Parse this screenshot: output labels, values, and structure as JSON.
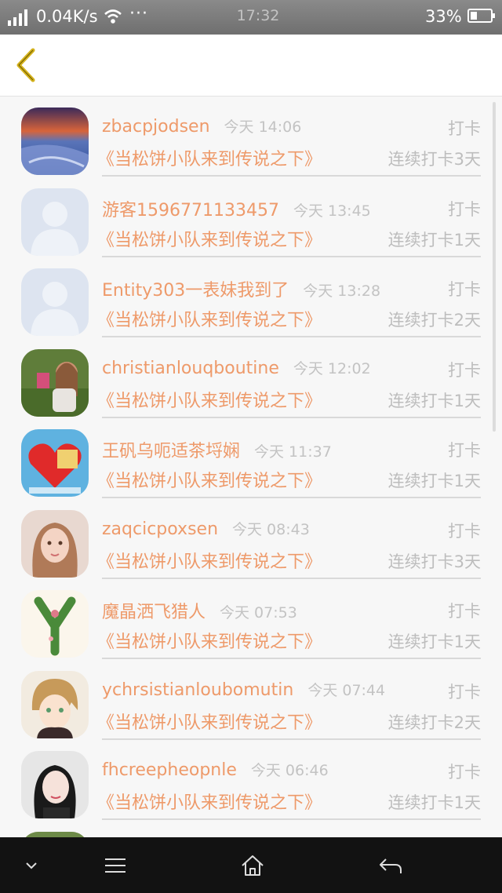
{
  "status_bar": {
    "network_speed": "0.04K/s",
    "more": "···",
    "time": "17:32",
    "battery_percent": "33%",
    "battery_level": 0.33
  },
  "header": {
    "back_icon": "chevron-left-icon"
  },
  "list": {
    "items": [
      {
        "user": "zbacpjodsen",
        "time": "今天 14:06",
        "action": "打卡",
        "book": "《当松饼小队来到传说之下》",
        "streak": "连续打卡3天",
        "avatar": "landscape-photo"
      },
      {
        "user": "游客1596771133457",
        "time": "今天 13:45",
        "action": "打卡",
        "book": "《当松饼小队来到传说之下》",
        "streak": "连续打卡1天",
        "avatar": "default-person"
      },
      {
        "user": "Entity303一表妹我到了",
        "time": "今天 13:28",
        "action": "打卡",
        "book": "《当松饼小队来到传说之下》",
        "streak": "连续打卡2天",
        "avatar": "default-person"
      },
      {
        "user": "christianlouqboutine",
        "time": "今天 12:02",
        "action": "打卡",
        "book": "《当松饼小队来到传说之下》",
        "streak": "连续打卡1天",
        "avatar": "girl-in-grass"
      },
      {
        "user": "王矾乌呃适茶埒娴",
        "time": "今天 11:37",
        "action": "打卡",
        "book": "《当松饼小队来到传说之下》",
        "streak": "连续打卡1天",
        "avatar": "heart-cartoon"
      },
      {
        "user": "zaqcicpoxsen",
        "time": "今天 08:43",
        "action": "打卡",
        "book": "《当松饼小队来到传说之下》",
        "streak": "连续打卡3天",
        "avatar": "girl-portrait"
      },
      {
        "user": "魔晶洒飞猎人",
        "time": "今天 07:53",
        "action": "打卡",
        "book": "《当松饼小队来到传说之下》",
        "streak": "连续打卡1天",
        "avatar": "letter-y"
      },
      {
        "user": "ychrsistianloubomutin",
        "time": "今天 07:44",
        "action": "打卡",
        "book": "《当松饼小队来到传说之下》",
        "streak": "连续打卡2天",
        "avatar": "anime-boy"
      },
      {
        "user": "fhcreepheopnle",
        "time": "今天 06:46",
        "action": "打卡",
        "book": "《当松饼小队来到传说之下》",
        "streak": "连续打卡1天",
        "avatar": "girl-selfie"
      },
      {
        "user": "",
        "time": "",
        "action": "",
        "book": "",
        "streak": "",
        "avatar": "partial-green"
      }
    ]
  },
  "nav_bar": {
    "buttons": [
      "chevron-down-icon",
      "menu-icon",
      "home-icon",
      "back-arrow-icon"
    ]
  },
  "colors": {
    "accent": "#ee9a6a",
    "muted": "#bdbdbd",
    "back_icon": "#d4b21c"
  }
}
